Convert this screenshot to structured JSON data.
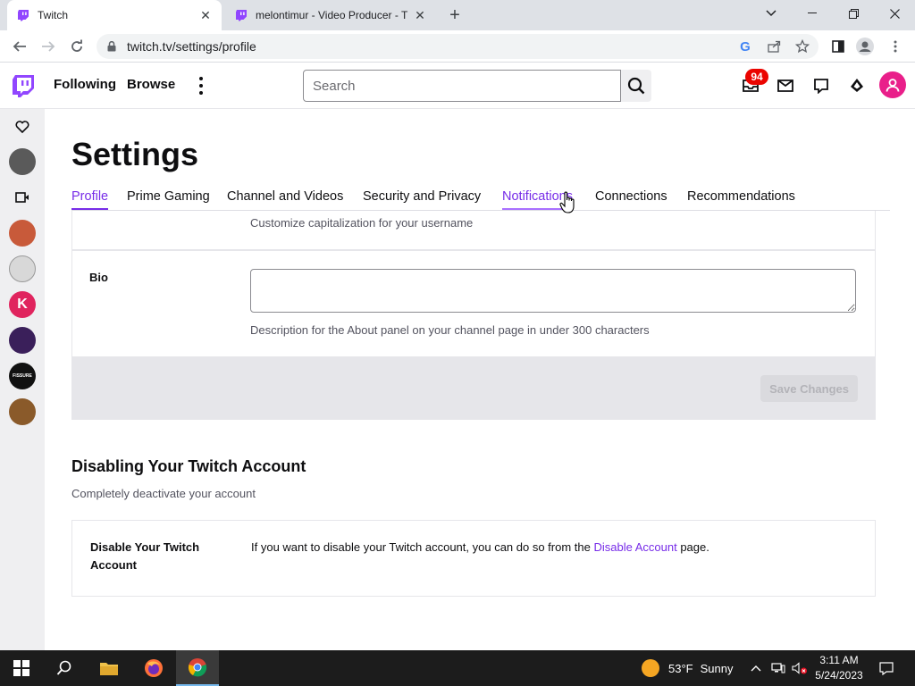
{
  "browser": {
    "tabs": [
      {
        "title": "Twitch",
        "active": true
      },
      {
        "title": "melontimur - Video Producer - T",
        "active": false
      }
    ],
    "url": "twitch.tv/settings/profile"
  },
  "twitch_nav": {
    "following": "Following",
    "browse": "Browse",
    "search_placeholder": "Search",
    "notification_count": "94"
  },
  "settings": {
    "title": "Settings",
    "tabs": [
      {
        "label": "Profile",
        "state": "active"
      },
      {
        "label": "Prime Gaming",
        "state": "normal"
      },
      {
        "label": "Channel and Videos",
        "state": "normal"
      },
      {
        "label": "Security and Privacy",
        "state": "normal"
      },
      {
        "label": "Notifications",
        "state": "hover"
      },
      {
        "label": "Connections",
        "state": "normal"
      },
      {
        "label": "Recommendations",
        "state": "normal"
      }
    ],
    "username_help": "Customize capitalization for your username",
    "bio": {
      "label": "Bio",
      "value": "",
      "help": "Description for the About panel on your channel page in under 300 characters"
    },
    "save_button": "Save Changes",
    "disable_section": {
      "title": "Disabling Your Twitch Account",
      "subtitle": "Completely deactivate your account",
      "label": "Disable Your Twitch Account",
      "text_before": "If you want to disable your Twitch account, you can do so from the ",
      "link": "Disable Account",
      "text_after": " page."
    }
  },
  "left_rail": {
    "avatars": [
      {
        "color": "#5a5a5a"
      },
      {
        "color": "#c85a3a"
      },
      {
        "color": "#d8d8d8"
      },
      {
        "color": "#e0245e",
        "letter": "K"
      },
      {
        "color": "#3a1f5a"
      },
      {
        "color": "#111111",
        "letter": "FISSURE"
      },
      {
        "color": "#8a5a2a"
      }
    ]
  },
  "taskbar": {
    "temperature": "53°F",
    "weather": "Sunny",
    "time": "3:11 AM",
    "date": "5/24/2023"
  },
  "colors": {
    "twitch_purple": "#772ce8",
    "badge_red": "#eb0400",
    "avatar_pink": "#e91f8a"
  }
}
